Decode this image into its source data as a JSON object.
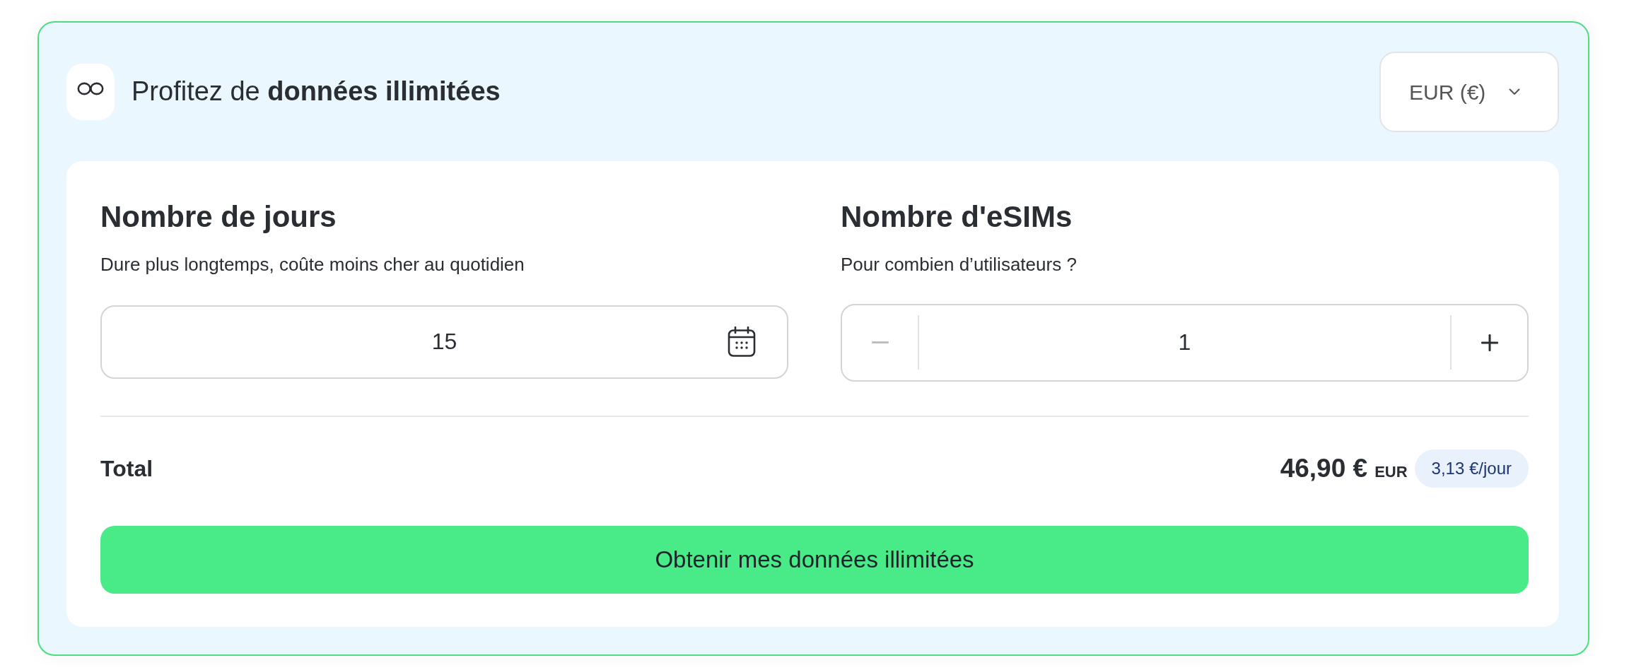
{
  "header": {
    "title": "Profitez de **données illimitées**",
    "currency": "EUR (€)"
  },
  "days": {
    "heading": "Nombre de jours",
    "hint": "Dure plus longtemps, coûte moins cher au quotidien",
    "value": "15"
  },
  "esims": {
    "heading": "Nombre d'eSIMs",
    "hint": "Pour combien d’utilisateurs ?",
    "value": "1",
    "decrement": {
      "disabled": true
    },
    "increment": {
      "disabled": false
    }
  },
  "total": {
    "label": "Total",
    "amount": "46,90 €",
    "currency": "EUR",
    "per_day": "3,13 €/jour"
  },
  "submit": {
    "label": "Obtenir mes données illimitées"
  }
}
